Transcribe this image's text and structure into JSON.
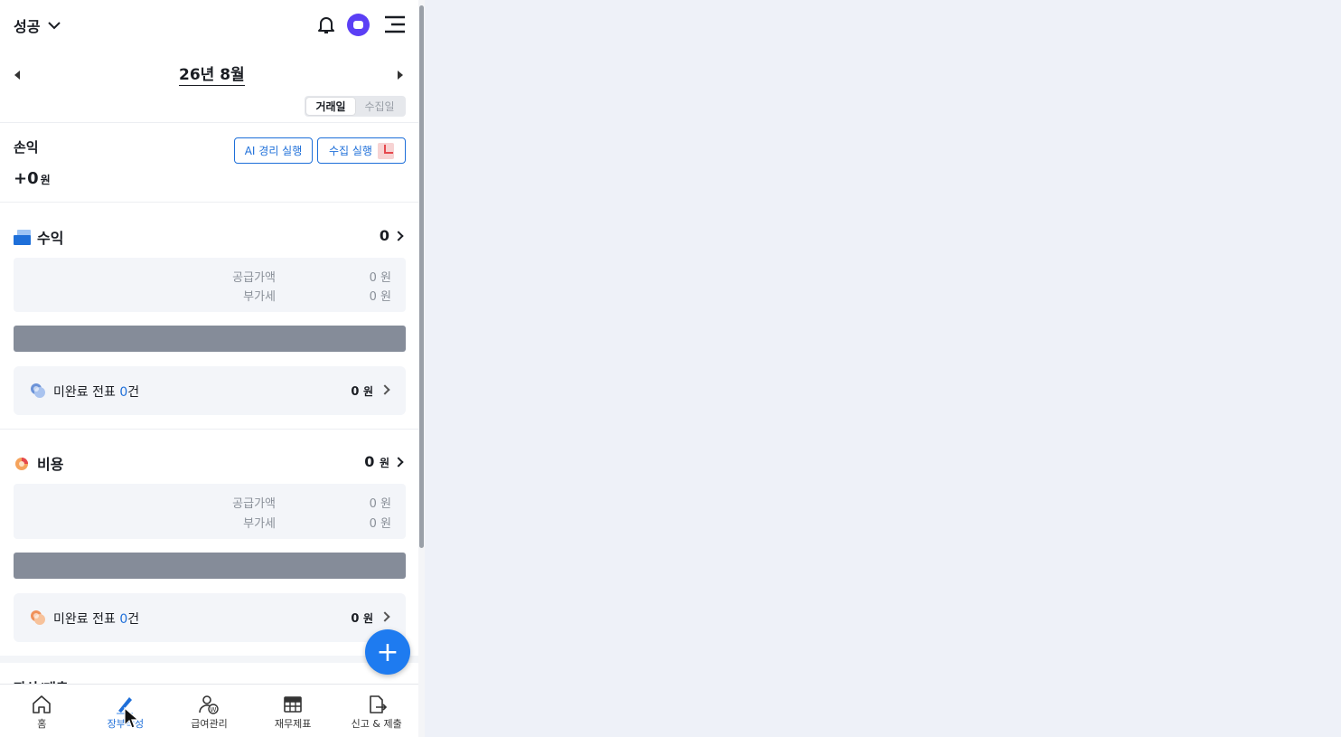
{
  "header": {
    "company": "성공",
    "icons": [
      "chevron-down-icon",
      "bell-icon",
      "chat-avatar-icon",
      "menu-icon"
    ]
  },
  "period": {
    "month_label": "26년 8월"
  },
  "date_toggle": {
    "options": [
      "거래일",
      "수집일"
    ],
    "selected": "거래일"
  },
  "profit_loss": {
    "title": "손익",
    "value": "+",
    "amount": "0",
    "unit": "원",
    "ai_button": "AI 경리 실행",
    "collect_button": "수집 실행"
  },
  "revenue": {
    "title": "수익",
    "total": "0",
    "supply_label": "공급가액",
    "supply_value": "0 원",
    "vat_label": "부가세",
    "vat_value": "0 원",
    "pending_prefix": "미완료 전표 ",
    "pending_count": "0",
    "pending_suffix": "건",
    "pending_amount": "0",
    "pending_unit": "원"
  },
  "expense": {
    "title": "비용",
    "total": "0",
    "unit": "원",
    "supply_label": "공급가액",
    "supply_value": "0 원",
    "vat_label": "부가세",
    "vat_value": "0 원",
    "pending_prefix": "미완료 전표 ",
    "pending_count": "0",
    "pending_suffix": "건",
    "pending_amount": "0",
    "pending_unit": "원"
  },
  "peek_section": "자산/대출",
  "fab": "+",
  "tabs": [
    {
      "label": "홈",
      "icon": "home-icon"
    },
    {
      "label": "장부작성",
      "icon": "pen-icon",
      "active": true
    },
    {
      "label": "급여관리",
      "icon": "payroll-icon"
    },
    {
      "label": "재무제표",
      "icon": "table-icon"
    },
    {
      "label": "신고 & 제출",
      "icon": "report-icon"
    }
  ],
  "colors": {
    "accent": "#1e6fd9",
    "fab": "#1e7bf0",
    "avatar": "#5b3ff5",
    "bar": "#858c99"
  }
}
